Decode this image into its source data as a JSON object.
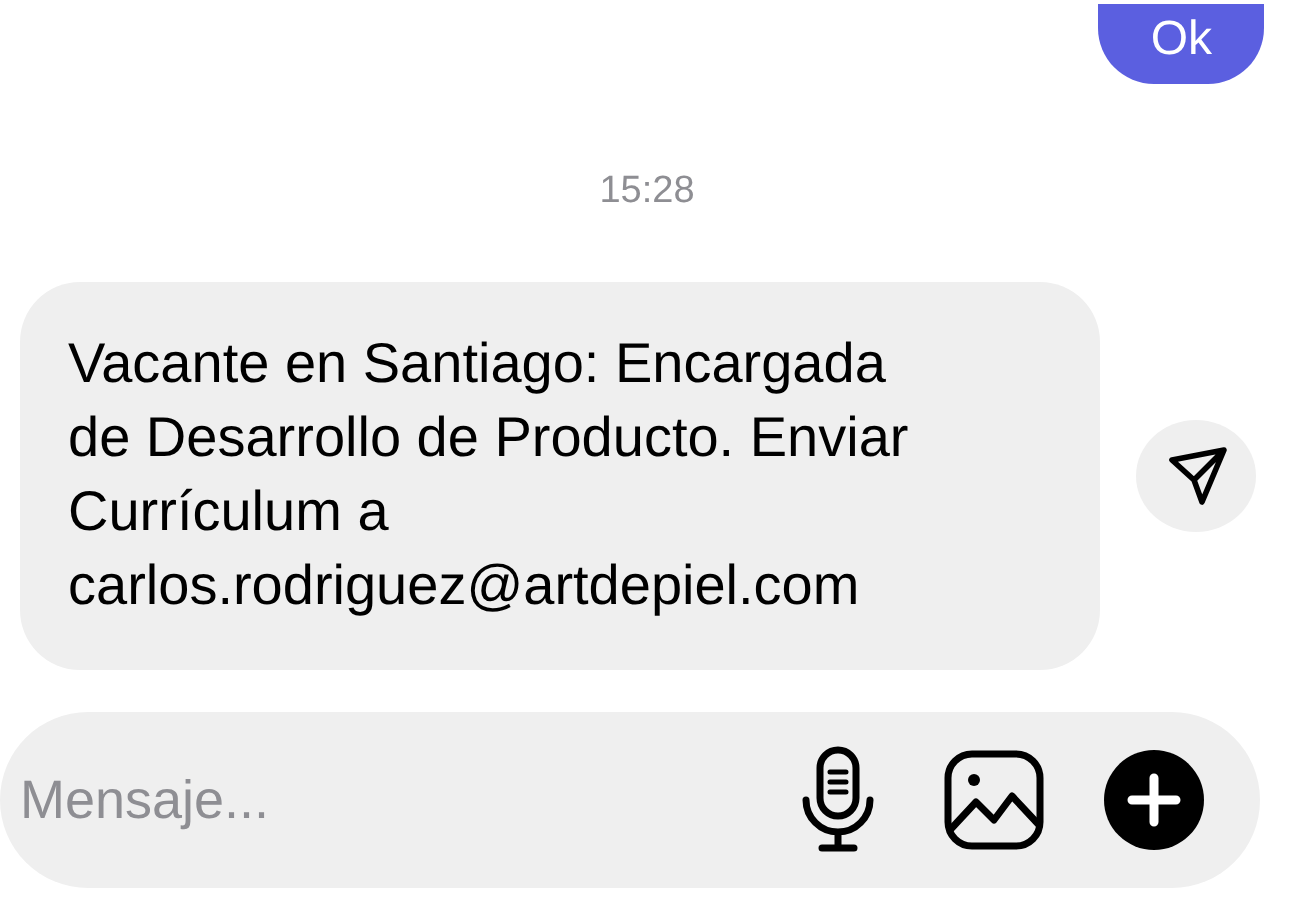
{
  "messages": [
    {
      "kind": "outgoing",
      "text": "Ok"
    },
    {
      "kind": "timestamp",
      "text": "15:28"
    },
    {
      "kind": "incoming",
      "text": "Vacante en Santiago: Encargada de Desarrollo de Producto. Enviar Currículum a carlos.rodriguez@artdepiel.com",
      "share": true
    }
  ],
  "composer": {
    "placeholder": "Mensaje..."
  }
}
